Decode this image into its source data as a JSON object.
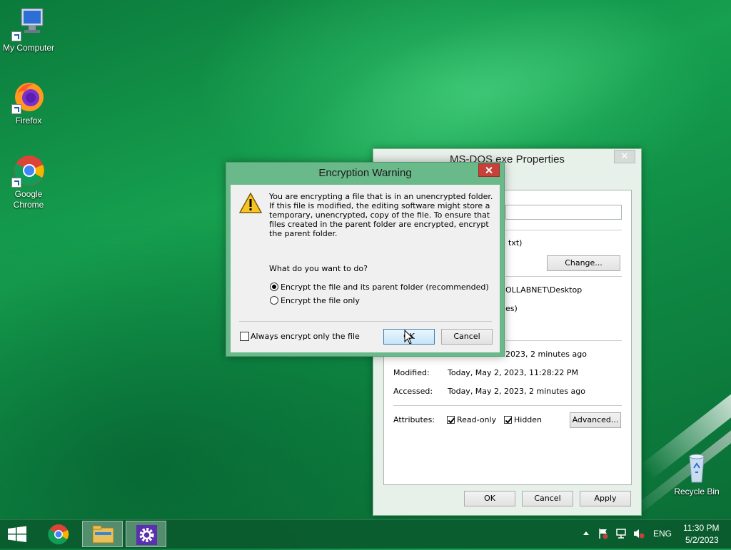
{
  "desktop": {
    "icons": [
      {
        "label": "My Computer",
        "icon": "computer-icon"
      },
      {
        "label": "Firefox",
        "icon": "firefox-icon"
      },
      {
        "label": "Google Chrome",
        "icon": "chrome-icon"
      },
      {
        "label": "Recycle Bin",
        "icon": "recycle-bin-icon"
      }
    ]
  },
  "properties": {
    "title": "MS-DOS exe Properties",
    "type_suffix": "txt)",
    "change_label": "Change...",
    "location_suffix": "OLLABNET\\Desktop",
    "size_suffix": "es)",
    "created_value": "2023, 2 minutes ago",
    "modified_label": "Modified:",
    "modified_value": "Today, May 2, 2023, 11:28:22 PM",
    "accessed_label": "Accessed:",
    "accessed_value": "Today, May 2, 2023, 2 minutes ago",
    "attributes_label": "Attributes:",
    "readonly_label": "Read-only",
    "hidden_label": "Hidden",
    "advanced_label": "Advanced...",
    "ok_label": "OK",
    "cancel_label": "Cancel",
    "apply_label": "Apply"
  },
  "encryption": {
    "title": "Encryption Warning",
    "message": "You are encrypting a file that is in an unencrypted folder. If this file is modified, the editing software might store a temporary, unencrypted, copy of the file. To ensure that files created in the parent folder are encrypted, encrypt the parent folder.",
    "question": "What do you want to do?",
    "option1": "Encrypt the file and its parent folder (recommended)",
    "option2": "Encrypt the file only",
    "always_label": "Always encrypt only the file",
    "ok_label": "OK",
    "cancel_label": "Cancel",
    "selected_option": 1
  },
  "taskbar": {
    "language": "ENG",
    "time": "11:30 PM",
    "date": "5/2/2023"
  }
}
